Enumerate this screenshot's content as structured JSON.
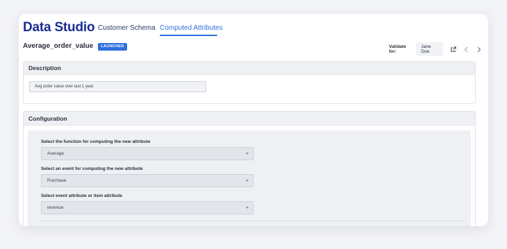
{
  "header": {
    "app_title": "Data Studio",
    "tabs": [
      {
        "label": "Customer Schema",
        "active": false
      },
      {
        "label": "Computed Attributes",
        "active": true
      }
    ]
  },
  "attribute": {
    "name": "Average_order_value",
    "status_badge": "LAUNCHED"
  },
  "validate": {
    "label": "Validate for:",
    "user": "Jane Doe",
    "icons": [
      "external-link-icon",
      "chevron-left-icon",
      "chevron-right-icon"
    ]
  },
  "description": {
    "title": "Description",
    "value": "Avg order value over last 1 year"
  },
  "configuration": {
    "title": "Configuration",
    "fields": [
      {
        "label": "Select the function for computing the new attribute",
        "value": "Average"
      },
      {
        "label": "Select an event for computing the new attribute",
        "value": "Purchase"
      },
      {
        "label": "Select event attribute or item attribute",
        "value": "revenue"
      }
    ]
  },
  "colors": {
    "brand": "#1a2d8f",
    "accent": "#2f6fde",
    "panel_header": "#eef0f4"
  }
}
